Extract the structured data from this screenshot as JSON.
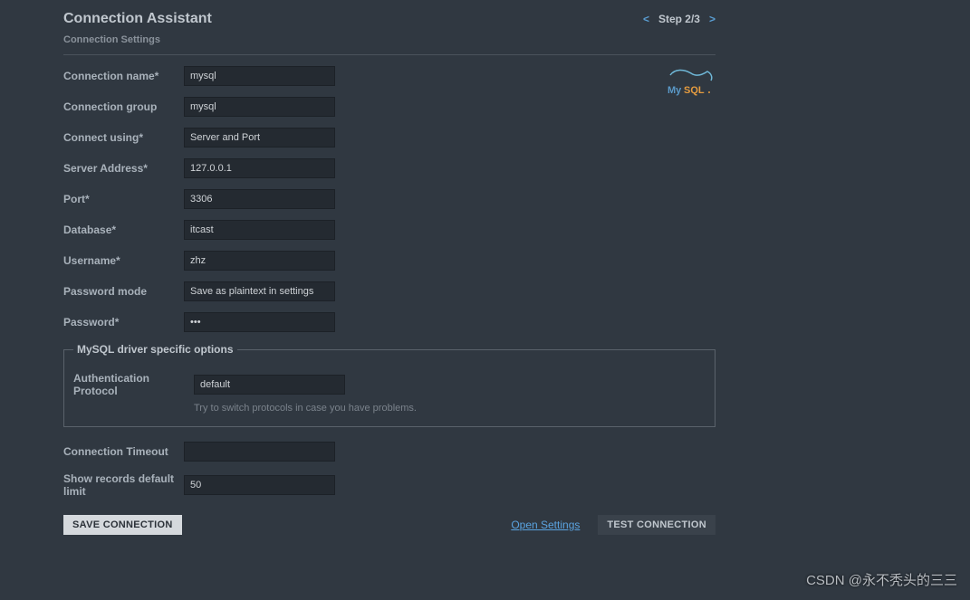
{
  "header": {
    "title": "Connection Assistant",
    "subtitle": "Connection Settings",
    "prev": "<",
    "step": "Step 2/3",
    "next": ">"
  },
  "logo": {
    "name": "MySQL"
  },
  "fields": {
    "conn_name": {
      "label": "Connection name*",
      "value": "mysql"
    },
    "conn_group": {
      "label": "Connection group",
      "value": "mysql"
    },
    "connect_using": {
      "label": "Connect using*",
      "value": "Server and Port"
    },
    "server": {
      "label": "Server Address*",
      "value": "127.0.0.1"
    },
    "port": {
      "label": "Port*",
      "value": "3306"
    },
    "database": {
      "label": "Database*",
      "value": "itcast"
    },
    "username": {
      "label": "Username*",
      "value": "zhz"
    },
    "pwd_mode": {
      "label": "Password mode",
      "value": "Save as plaintext in settings"
    },
    "password": {
      "label": "Password*",
      "value": "•••"
    },
    "auth_proto": {
      "label": "Authentication Protocol",
      "value": "default"
    },
    "timeout": {
      "label": "Connection Timeout",
      "value": ""
    },
    "limit": {
      "label": "Show records default limit",
      "value": "50"
    }
  },
  "driver": {
    "legend": "MySQL driver specific options",
    "hint": "Try to switch protocols in case you have problems."
  },
  "footer": {
    "save": "Save Connection",
    "open": "Open Settings",
    "test": "Test Connection"
  },
  "watermark": "CSDN @永不秃头的三三"
}
